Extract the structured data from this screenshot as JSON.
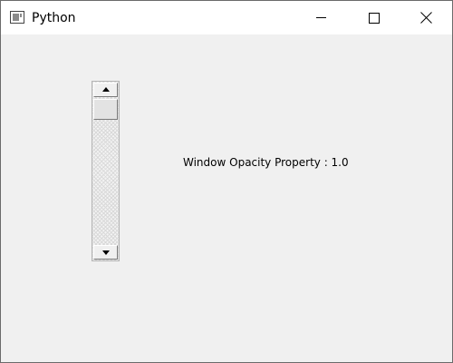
{
  "window": {
    "title": "Python",
    "icon": "python-window-icon",
    "controls": {
      "minimize_icon": "minimize-icon",
      "maximize_icon": "maximize-icon",
      "close_icon": "close-icon"
    }
  },
  "content": {
    "label": "Window Opacity Property : 1.0",
    "scrollbar": {
      "orientation": "vertical",
      "value_fraction": 0.0,
      "up_icon": "arrow-up-icon",
      "down_icon": "arrow-down-icon"
    }
  },
  "colors": {
    "titlebar": "#ffffff",
    "client_area": "#f0f0f0",
    "border": "#6b6b6b"
  }
}
